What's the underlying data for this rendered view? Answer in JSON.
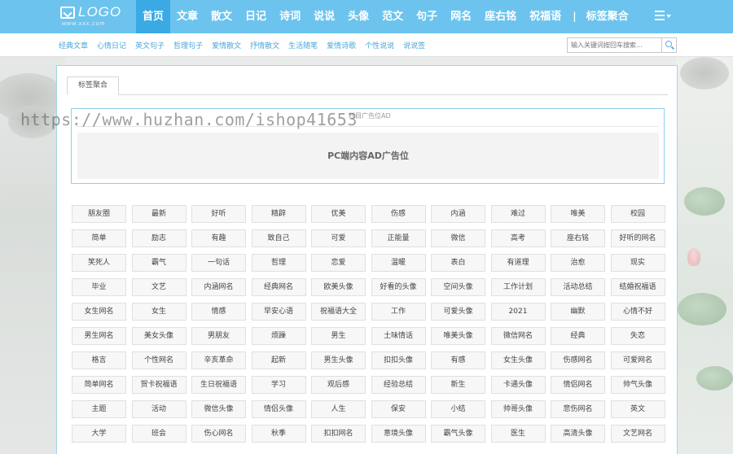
{
  "logo": {
    "text": "LOGO",
    "sub": "www.xxx.com"
  },
  "nav": {
    "items": [
      "首页",
      "文章",
      "散文",
      "日记",
      "诗词",
      "说说",
      "头像",
      "范文",
      "句子",
      "网名",
      "座右铭",
      "祝福语"
    ],
    "separator": "|",
    "extra": "标签聚合",
    "menu_icon": "list-icon"
  },
  "subnav": {
    "items": [
      "经典文章",
      "心情日记",
      "英文句子",
      "哲理句子",
      "爱情散文",
      "抒情散文",
      "生活随笔",
      "爱情诗歌",
      "个性说说",
      "说说签"
    ]
  },
  "search": {
    "placeholder": "输入关键词按回车搜索...",
    "icon": "search-icon"
  },
  "tab": {
    "label": "标签聚合"
  },
  "ad": {
    "label": "栏目广告位AD",
    "text": "PC端内容AD广告位"
  },
  "tags": [
    "朋友圈",
    "最新",
    "好听",
    "精辟",
    "优美",
    "伤感",
    "内涵",
    "难过",
    "唯美",
    "校园",
    "简单",
    "励志",
    "有趣",
    "致自己",
    "可爱",
    "正能量",
    "微信",
    "高考",
    "座右铭",
    "好听的网名",
    "笑死人",
    "霸气",
    "一句话",
    "哲理",
    "恋爱",
    "温暖",
    "表白",
    "有道理",
    "治愈",
    "现实",
    "毕业",
    "文艺",
    "内涵网名",
    "经典网名",
    "欧美头像",
    "好看的头像",
    "空间头像",
    "工作计划",
    "活动总结",
    "结婚祝福语",
    "女生网名",
    "女生",
    "情感",
    "早安心语",
    "祝福语大全",
    "工作",
    "可爱头像",
    "2021",
    "幽默",
    "心情不好",
    "男生网名",
    "美女头像",
    "男朋友",
    "烦躁",
    "男生",
    "土味情话",
    "唯美头像",
    "微信网名",
    "经典",
    "失恋",
    "格言",
    "个性网名",
    "辛亥革命",
    "起新",
    "男生头像",
    "扣扣头像",
    "有感",
    "女生头像",
    "伤感网名",
    "可爱网名",
    "简单网名",
    "贺卡祝福语",
    "生日祝福语",
    "学习",
    "观后感",
    "经验总结",
    "新生",
    "卡通头像",
    "情侣网名",
    "帅气头像",
    "主题",
    "活动",
    "微信头像",
    "情侣头像",
    "人生",
    "保安",
    "小结",
    "帅哥头像",
    "悲伤网名",
    "英文",
    "大学",
    "班会",
    "伤心网名",
    "秋季",
    "扣扣网名",
    "意境头像",
    "霸气头像",
    "医生",
    "高清头像",
    "文艺网名"
  ],
  "watermark": "https://www.huzhan.com/ishop41653",
  "colors": {
    "topbar": "#6cc3ee",
    "active": "#3aa9e4",
    "sublink": "#4aa6d8",
    "panel_border": "#9fd8e8"
  }
}
